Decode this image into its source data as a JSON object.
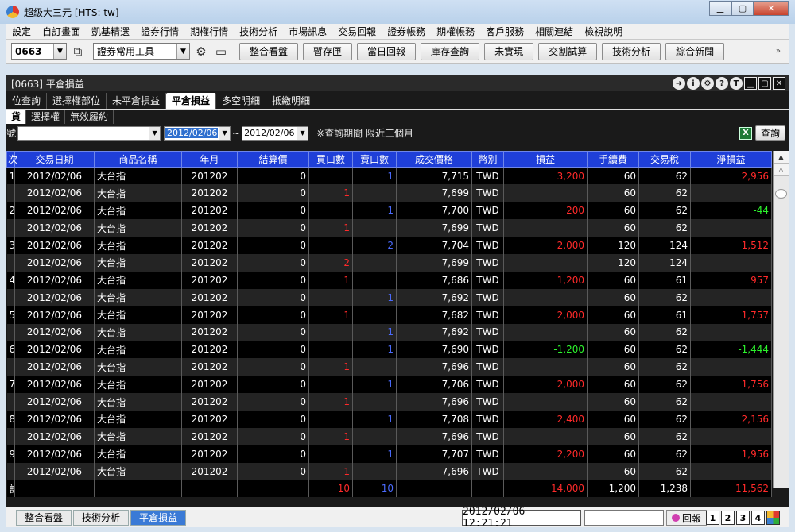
{
  "window": {
    "title": "超級大三元  [HTS: tw]"
  },
  "menu": [
    "設定",
    "自訂畫面",
    "凱基精選",
    "證券行情",
    "期權行情",
    "技術分析",
    "市場訊息",
    "交易回報",
    "證券帳務",
    "期權帳務",
    "客戶服務",
    "相關連結",
    "檢視說明"
  ],
  "toolbar": {
    "code_value": "0663",
    "tool_combo": "證券常用工具",
    "buttons": [
      "整合看盤",
      "暫存匣",
      "當日回報",
      "庫存查詢",
      "未實現",
      "交割試算",
      "技術分析",
      "綜合新聞"
    ]
  },
  "panel": {
    "title": "[0663] 平倉損益",
    "tabs": [
      "位查詢",
      "選擇權部位",
      "未平倉損益",
      "平倉損益",
      "多空明細",
      "抵繳明細"
    ],
    "active_tab": "平倉損益",
    "subtabs": [
      "貨",
      "選擇權",
      "無效履約"
    ],
    "filter": {
      "account_label": "號",
      "account_value": "",
      "date_from": "2012/02/06",
      "tilde": "~",
      "date_to": "2012/02/06",
      "note": "※查詢期間 限近三個月",
      "query_button": "查詢"
    }
  },
  "table": {
    "headers": [
      "次",
      "交易日期",
      "商品名稱",
      "年月",
      "結算價",
      "買口數",
      "賣口數",
      "成交價格",
      "幣別",
      "損益",
      "手續費",
      "交易稅",
      "淨損益"
    ],
    "rows": [
      {
        "seq": "1",
        "date": "2012/02/06",
        "name": "大台指",
        "ym": "201202",
        "settle": "0",
        "buy": "",
        "sell": "1",
        "price": "7,715",
        "cur": "TWD",
        "pl": "3,200",
        "pl_c": "red",
        "fee": "60",
        "tax": "62",
        "net": "2,956",
        "net_c": "red"
      },
      {
        "seq": "",
        "date": "2012/02/06",
        "name": "大台指",
        "ym": "201202",
        "settle": "0",
        "buy": "1",
        "sell": "",
        "price": "7,699",
        "cur": "TWD",
        "pl": "",
        "pl_c": "",
        "fee": "60",
        "tax": "62",
        "net": "",
        "net_c": ""
      },
      {
        "seq": "2",
        "date": "2012/02/06",
        "name": "大台指",
        "ym": "201202",
        "settle": "0",
        "buy": "",
        "sell": "1",
        "price": "7,700",
        "cur": "TWD",
        "pl": "200",
        "pl_c": "red",
        "fee": "60",
        "tax": "62",
        "net": "-44",
        "net_c": "green"
      },
      {
        "seq": "",
        "date": "2012/02/06",
        "name": "大台指",
        "ym": "201202",
        "settle": "0",
        "buy": "1",
        "sell": "",
        "price": "7,699",
        "cur": "TWD",
        "pl": "",
        "pl_c": "",
        "fee": "60",
        "tax": "62",
        "net": "",
        "net_c": ""
      },
      {
        "seq": "3",
        "date": "2012/02/06",
        "name": "大台指",
        "ym": "201202",
        "settle": "0",
        "buy": "",
        "sell": "2",
        "price": "7,704",
        "cur": "TWD",
        "pl": "2,000",
        "pl_c": "red",
        "fee": "120",
        "tax": "124",
        "net": "1,512",
        "net_c": "red"
      },
      {
        "seq": "",
        "date": "2012/02/06",
        "name": "大台指",
        "ym": "201202",
        "settle": "0",
        "buy": "2",
        "sell": "",
        "price": "7,699",
        "cur": "TWD",
        "pl": "",
        "pl_c": "",
        "fee": "120",
        "tax": "124",
        "net": "",
        "net_c": ""
      },
      {
        "seq": "4",
        "date": "2012/02/06",
        "name": "大台指",
        "ym": "201202",
        "settle": "0",
        "buy": "1",
        "sell": "",
        "price": "7,686",
        "cur": "TWD",
        "pl": "1,200",
        "pl_c": "red",
        "fee": "60",
        "tax": "61",
        "net": "957",
        "net_c": "red"
      },
      {
        "seq": "",
        "date": "2012/02/06",
        "name": "大台指",
        "ym": "201202",
        "settle": "0",
        "buy": "",
        "sell": "1",
        "price": "7,692",
        "cur": "TWD",
        "pl": "",
        "pl_c": "",
        "fee": "60",
        "tax": "62",
        "net": "",
        "net_c": ""
      },
      {
        "seq": "5",
        "date": "2012/02/06",
        "name": "大台指",
        "ym": "201202",
        "settle": "0",
        "buy": "1",
        "sell": "",
        "price": "7,682",
        "cur": "TWD",
        "pl": "2,000",
        "pl_c": "red",
        "fee": "60",
        "tax": "61",
        "net": "1,757",
        "net_c": "red"
      },
      {
        "seq": "",
        "date": "2012/02/06",
        "name": "大台指",
        "ym": "201202",
        "settle": "0",
        "buy": "",
        "sell": "1",
        "price": "7,692",
        "cur": "TWD",
        "pl": "",
        "pl_c": "",
        "fee": "60",
        "tax": "62",
        "net": "",
        "net_c": ""
      },
      {
        "seq": "6",
        "date": "2012/02/06",
        "name": "大台指",
        "ym": "201202",
        "settle": "0",
        "buy": "",
        "sell": "1",
        "price": "7,690",
        "cur": "TWD",
        "pl": "-1,200",
        "pl_c": "green",
        "fee": "60",
        "tax": "62",
        "net": "-1,444",
        "net_c": "green"
      },
      {
        "seq": "",
        "date": "2012/02/06",
        "name": "大台指",
        "ym": "201202",
        "settle": "0",
        "buy": "1",
        "sell": "",
        "price": "7,696",
        "cur": "TWD",
        "pl": "",
        "pl_c": "",
        "fee": "60",
        "tax": "62",
        "net": "",
        "net_c": ""
      },
      {
        "seq": "7",
        "date": "2012/02/06",
        "name": "大台指",
        "ym": "201202",
        "settle": "0",
        "buy": "",
        "sell": "1",
        "price": "7,706",
        "cur": "TWD",
        "pl": "2,000",
        "pl_c": "red",
        "fee": "60",
        "tax": "62",
        "net": "1,756",
        "net_c": "red"
      },
      {
        "seq": "",
        "date": "2012/02/06",
        "name": "大台指",
        "ym": "201202",
        "settle": "0",
        "buy": "1",
        "sell": "",
        "price": "7,696",
        "cur": "TWD",
        "pl": "",
        "pl_c": "",
        "fee": "60",
        "tax": "62",
        "net": "",
        "net_c": ""
      },
      {
        "seq": "8",
        "date": "2012/02/06",
        "name": "大台指",
        "ym": "201202",
        "settle": "0",
        "buy": "",
        "sell": "1",
        "price": "7,708",
        "cur": "TWD",
        "pl": "2,400",
        "pl_c": "red",
        "fee": "60",
        "tax": "62",
        "net": "2,156",
        "net_c": "red"
      },
      {
        "seq": "",
        "date": "2012/02/06",
        "name": "大台指",
        "ym": "201202",
        "settle": "0",
        "buy": "1",
        "sell": "",
        "price": "7,696",
        "cur": "TWD",
        "pl": "",
        "pl_c": "",
        "fee": "60",
        "tax": "62",
        "net": "",
        "net_c": ""
      },
      {
        "seq": "9",
        "date": "2012/02/06",
        "name": "大台指",
        "ym": "201202",
        "settle": "0",
        "buy": "",
        "sell": "1",
        "price": "7,707",
        "cur": "TWD",
        "pl": "2,200",
        "pl_c": "red",
        "fee": "60",
        "tax": "62",
        "net": "1,956",
        "net_c": "red"
      },
      {
        "seq": "",
        "date": "2012/02/06",
        "name": "大台指",
        "ym": "201202",
        "settle": "0",
        "buy": "1",
        "sell": "",
        "price": "7,696",
        "cur": "TWD",
        "pl": "",
        "pl_c": "",
        "fee": "60",
        "tax": "62",
        "net": "",
        "net_c": ""
      }
    ],
    "total": {
      "label": "計",
      "buy": "10",
      "sell": "10",
      "pl": "14,000",
      "fee": "1,200",
      "tax": "1,238",
      "net": "11,562"
    }
  },
  "statusbar": {
    "tabs": [
      "整合看盤",
      "技術分析",
      "平倉損益"
    ],
    "active": "平倉損益",
    "datetime": "2012/02/06 12:21:21",
    "report_button": "回報",
    "pages": [
      "1",
      "2",
      "3",
      "4"
    ]
  },
  "colors": {
    "header_blue": "#1f3fd8",
    "profit_red": "#ff2a2a",
    "loss_green": "#2cf22c",
    "sell_blue": "#4b6bff"
  }
}
